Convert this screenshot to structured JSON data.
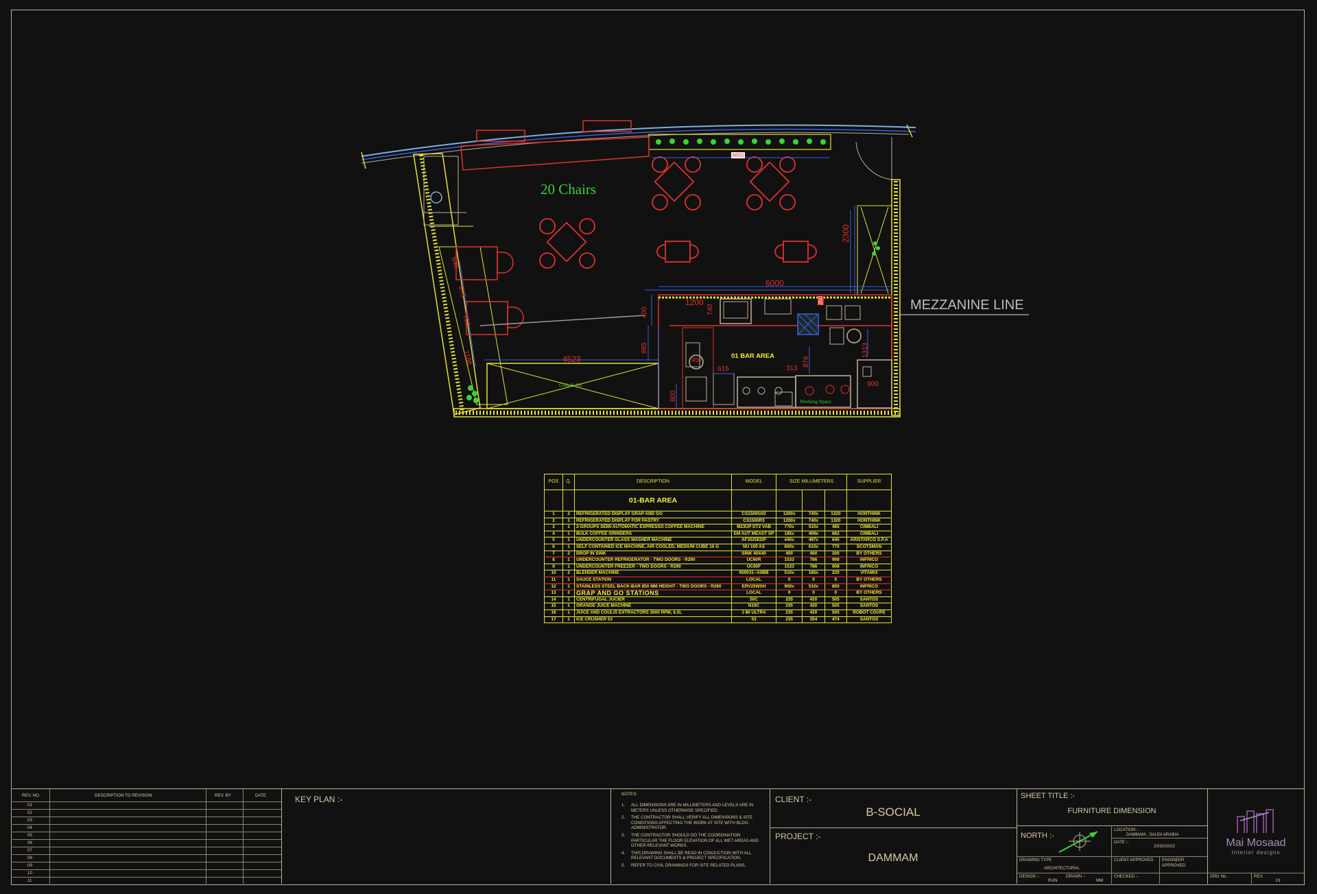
{
  "plan": {
    "chairs_label": "20 Chairs",
    "mezzanine_label": "MEZZANINE LINE",
    "bar_area_label": "01  BAR AREA",
    "grab_label": "Grab & Go",
    "working_space_label": "Working Space",
    "dimensions": {
      "d4650": "4650",
      "d2300": "2300",
      "d6000": "6000",
      "d1200": "1200",
      "d400a": "400",
      "d740": "740",
      "d4523": "4523",
      "d985": "985",
      "d800": "800",
      "d615": "615",
      "d313": "313",
      "d876": "876",
      "d1313": "1313",
      "d900": "900",
      "d1186": "1186",
      "d675": "675",
      "d700": "700",
      "d640": "640",
      "d450": "450",
      "d350": "350"
    },
    "colors": {
      "furniture": "#e0322c",
      "walls": "#e8e23a",
      "dimension": "#3a5fe0",
      "dim_text": "#e0322c",
      "label_green": "#3ad23a",
      "glass": "#7fb0e0"
    }
  },
  "bom": {
    "headers": [
      "POS",
      "Q.",
      "DESCRIPTION",
      "MODEL",
      "SIZE MILLIMETERS",
      "SUPPLIER"
    ],
    "section": "01-BAR AREA",
    "rows": [
      {
        "pos": "1",
        "q": "2",
        "desc": "REFRIGERATED DISPLAY GRAP AND GO",
        "model": "CS1500G03",
        "w": "1200x",
        "d": "740x",
        "h": "1320",
        "supplier": "HONTHINK"
      },
      {
        "pos": "2",
        "q": "1",
        "desc": "REFRIGERATED DISPLAY FOR PASTRY",
        "model": "CS1500R3",
        "w": "1200x",
        "d": "740x",
        "h": "1320",
        "supplier": "HONTHINK"
      },
      {
        "pos": "3",
        "q": "1",
        "desc": "2-GROUPS SEMI-AUTOMATIC ESPRESSO COFFEE MACHINE",
        "model": "M23UP  DT2  VAB",
        "w": "770x",
        "d": "510x",
        "h": "485",
        "supplier": "CIMBALI"
      },
      {
        "pos": "4",
        "q": "1",
        "desc": "BULK COFFEE GRINDERS",
        "model": "EM  AUT  MEAST  SP",
        "w": "185x",
        "d": "409x",
        "h": "662",
        "supplier": "CIMBALI"
      },
      {
        "pos": "5",
        "q": "1",
        "desc": "UNDERCOUNTER GLASS WASHER MACHINE",
        "model": "AF3525EDP",
        "w": "440x",
        "d": "497x",
        "h": "640",
        "supplier": "ARISTARCO  S.P.A"
      },
      {
        "pos": "6",
        "q": "1",
        "desc": "SELF CONTAINED ICE MACHINE, AIR COOLED, MEDIUM CUBE 10 G",
        "model": "NU  100  AS",
        "w": "600x",
        "d": "610x",
        "h": "770",
        "supplier": "SCOTSMAN"
      },
      {
        "pos": "7",
        "q": "2",
        "desc": "DROP IN SINK",
        "model": "SINK  40X40",
        "w": "400",
        "d": "400",
        "h": "200",
        "supplier": "BY  OTHERS",
        "red": true
      },
      {
        "pos": "8",
        "q": "1",
        "desc": "UNDERCOUNTER REFRIGERATOR - TWO DOORS - R290",
        "model": "UC60R",
        "w": "1533",
        "d": "786",
        "h": "908",
        "supplier": "INFRICO"
      },
      {
        "pos": "9",
        "q": "1",
        "desc": "UNDERCOUNTER FREEZER - TWO DOORS - R290",
        "model": "UC60F",
        "w": "1533",
        "d": "786",
        "h": "908",
        "supplier": "INFRICO"
      },
      {
        "pos": "10",
        "q": "2",
        "desc": "BLENDER MACHINE",
        "model": "050031--A0BB",
        "w": "510x",
        "d": "185x",
        "h": "220",
        "supplier": "VITAMIX",
        "red": true
      },
      {
        "pos": "11",
        "q": "1",
        "desc": "SAUCE STATION",
        "model": "LOCAL",
        "w": "0",
        "d": "0",
        "h": "0",
        "supplier": "BY  OTHERS",
        "red": true
      },
      {
        "pos": "12",
        "q": "1",
        "desc": "STAINLESS STEEL BACK-BAR 850 MM HEIGHT - TWO DOORS - R290",
        "model": "ERV25WSH",
        "w": "900x",
        "d": "510x",
        "h": "850",
        "supplier": "INFRICO",
        "red": true
      },
      {
        "pos": "13",
        "q": "2",
        "desc": "GRAP AND GO STATIONS",
        "model": "LOCAL",
        "w": "0",
        "d": "0",
        "h": "0",
        "supplier": "BY  OTHERS",
        "big": true
      },
      {
        "pos": "14",
        "q": "1",
        "desc": "CENTRIFUGAL JUCIER",
        "model": "50C",
        "w": "235",
        "d": "420",
        "h": "505",
        "supplier": "SANTOS"
      },
      {
        "pos": "15",
        "q": "1",
        "desc": "ORANGE JUICE MACHINE",
        "model": "N10C",
        "w": "235",
        "d": "420",
        "h": "505",
        "supplier": "SANTOS"
      },
      {
        "pos": "16",
        "q": "1",
        "desc": "JUICE AND COULIS EXTRACTORS 3000 RPM, 6.5L",
        "model": "J  80  ULTRA",
        "w": "235",
        "d": "420",
        "h": "505",
        "supplier": "ROBOT  COUPE"
      },
      {
        "pos": "17",
        "q": "1",
        "desc": "ICE CRUSHER 53",
        "model": "53",
        "w": "235",
        "d": "354",
        "h": "474",
        "supplier": "SANTOS"
      }
    ]
  },
  "titleblock": {
    "rev_headers": {
      "no": "REV. NO.",
      "desc": "DESCRIPTION TO REVISION",
      "by": "REV. BY",
      "date": "DATE"
    },
    "rev_numbers": [
      "01",
      "02",
      "03",
      "04",
      "05",
      "06",
      "07",
      "08",
      "09",
      "10",
      "11"
    ],
    "key_plan": "KEY PLAN :-",
    "notes_title": "NOTES:",
    "notes": [
      {
        "n": "1.",
        "t": "ALL DIMENSIONS ARE IN MILLIMETERS AND LEVELS ARE IN METERS UNLESS OTHERWISE SPECIFIED."
      },
      {
        "n": "2.",
        "t": "THE CONTRACTOR SHALL VERIFY ALL DIMENSIONS & SITE CONDITIONS AFFECTING THE WORK AT SITE WITH BLDG. ADMINISTRATOR."
      },
      {
        "n": "3.",
        "t": "THE CONTRACTOR SHOULD DO THE COORDINATION PARTICULAR THE FLOOR ELEVATION OF ALL WET AREAS AND OTHER RELEVANT WORKS."
      },
      {
        "n": "4.",
        "t": "THIS DRAWING SHALL BE READ IN CONJUCTION WITH ALL RELEVANT DOCUMENTS & PROJECT SPECIFICATION."
      },
      {
        "n": "5.",
        "t": "REFER TO CIVIL DRAWINGS FOR SITE RELATED PLANS."
      }
    ],
    "client_label": "CLIENT :-",
    "client": "B-SOCIAL",
    "project_label": "PROJECT :-",
    "project": "DAMMAM",
    "sheet_title_label": "SHEET TITLE :-",
    "sheet_title": "FURNITURE DIMENSION",
    "north_label": "NORTH :-",
    "location_label": "LOCATION :-",
    "location": "DAMMAM , SAUDI ARABIA",
    "date_label": "DATE :-",
    "date": "10/10/2022",
    "client_approved": "CLIENT APPROVED",
    "engineer_approved": "ENGINEER APPROVED",
    "drawing_type_label": "DRAWING TYPE",
    "drawing_type": "ARCHITECTURAL",
    "design_label": "DESIGN :-",
    "design": "RUN",
    "drawn_label": "DRAWN :-",
    "drawn": "MM",
    "checked_label": "CHECKED :-",
    "drg_no_label": "DRG No.",
    "rev_label": "REV.",
    "rev": "01",
    "brand": "Mai Mosaad",
    "brand_sub": "Interior designs"
  }
}
